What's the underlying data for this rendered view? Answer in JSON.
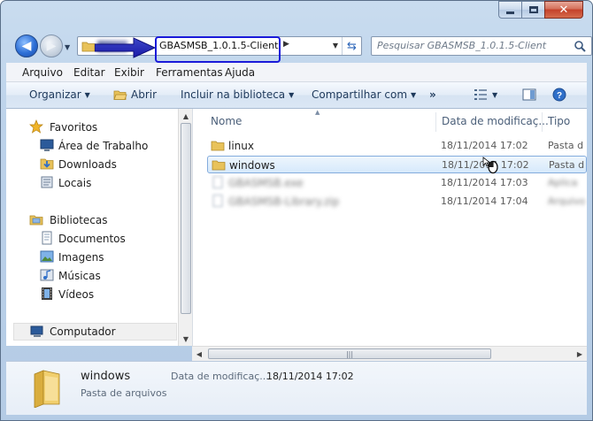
{
  "address": {
    "current_folder": "GBASMSB_1.0.1.5-Client"
  },
  "search": {
    "placeholder": "Pesquisar GBASMSB_1.0.1.5-Client"
  },
  "menu": {
    "items": [
      {
        "label": "Arquivo"
      },
      {
        "label": "Editar"
      },
      {
        "label": "Exibir"
      },
      {
        "label": "Ferramentas"
      },
      {
        "label": "Ajuda"
      }
    ]
  },
  "commands": {
    "organize": "Organizar",
    "open": "Abrir",
    "include_library": "Incluir na biblioteca",
    "share": "Compartilhar com",
    "more": "»"
  },
  "nav": {
    "favorites": "Favoritos",
    "desktop": "Área de Trabalho",
    "downloads": "Downloads",
    "places": "Locais",
    "libraries": "Bibliotecas",
    "documents": "Documentos",
    "images": "Imagens",
    "music": "Músicas",
    "videos": "Vídeos",
    "computer": "Computador"
  },
  "columns": {
    "name": "Nome",
    "date": "Data de modificaç...",
    "type": "Tipo"
  },
  "files": [
    {
      "name": "linux",
      "date": "18/11/2014 17:02",
      "type": "Pasta d"
    },
    {
      "name": "windows",
      "date": "18/11/2014 17:02",
      "type": "Pasta d",
      "selected": true
    },
    {
      "name": "GBASMSB.exe",
      "date": "18/11/2014 17:03",
      "type": "Aplica",
      "blurred": true
    },
    {
      "name": "GBASMSB-Library.zip",
      "date": "18/11/2014 17:04",
      "type": "Arquivo",
      "blurred": true
    }
  ],
  "details": {
    "name": "windows",
    "type": "Pasta de arquivos",
    "date_label": "Data de modificaç...",
    "date_value": "18/11/2014 17:02"
  },
  "colors": {
    "accent": "#1a1ad9",
    "selection_border": "#84acdd",
    "folder": "#e8c25a"
  }
}
